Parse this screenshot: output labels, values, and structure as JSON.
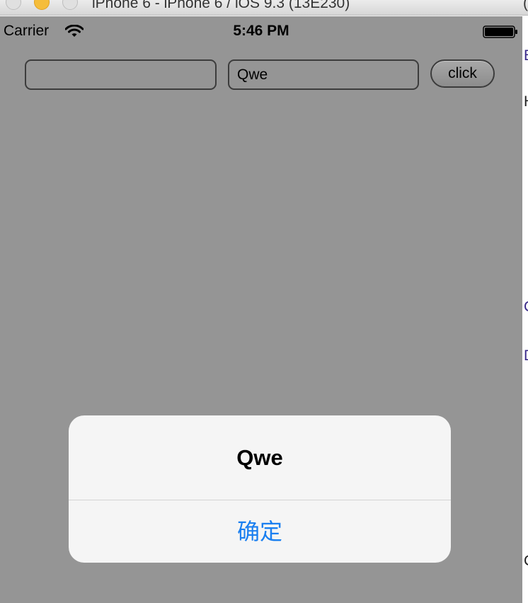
{
  "window": {
    "title": "iPhone 6 - iPhone 6 / iOS 9.3 (13E230)",
    "title_right": "(",
    "buttons": [
      "close",
      "minimize",
      "zoom"
    ]
  },
  "statusbar": {
    "carrier": "Carrier",
    "wifi_icon": "wifi-icon",
    "time": "5:46 PM",
    "battery_icon": "battery-icon"
  },
  "form": {
    "input1_value": "",
    "input2_value": "Qwe",
    "button_label": "click"
  },
  "alert": {
    "title": "Qwe",
    "button_label": "确定",
    "button_color": "#1a7ff0"
  },
  "gutter_fragments": [
    "E",
    "H",
    "C",
    "D",
    "C"
  ],
  "colors": {
    "device_background": "#959595",
    "alert_background": "#f5f5f5"
  }
}
